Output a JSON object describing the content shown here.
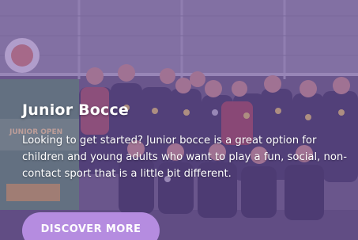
{
  "card": {
    "title": "Junior Bocce",
    "description": "Looking to get started? Junior bocce is a great option for children and young adults who want to play a fun, social, non-contact sport that is a little bit different.",
    "cta_label": "DISCOVER MORE",
    "banner_text": "JUNIOR OPEN",
    "photo_subject": "group photo of junior bocce players with medals",
    "colors": {
      "overlay": "#7856a8",
      "button": "#b58ce0",
      "text": "#ffffff"
    }
  }
}
